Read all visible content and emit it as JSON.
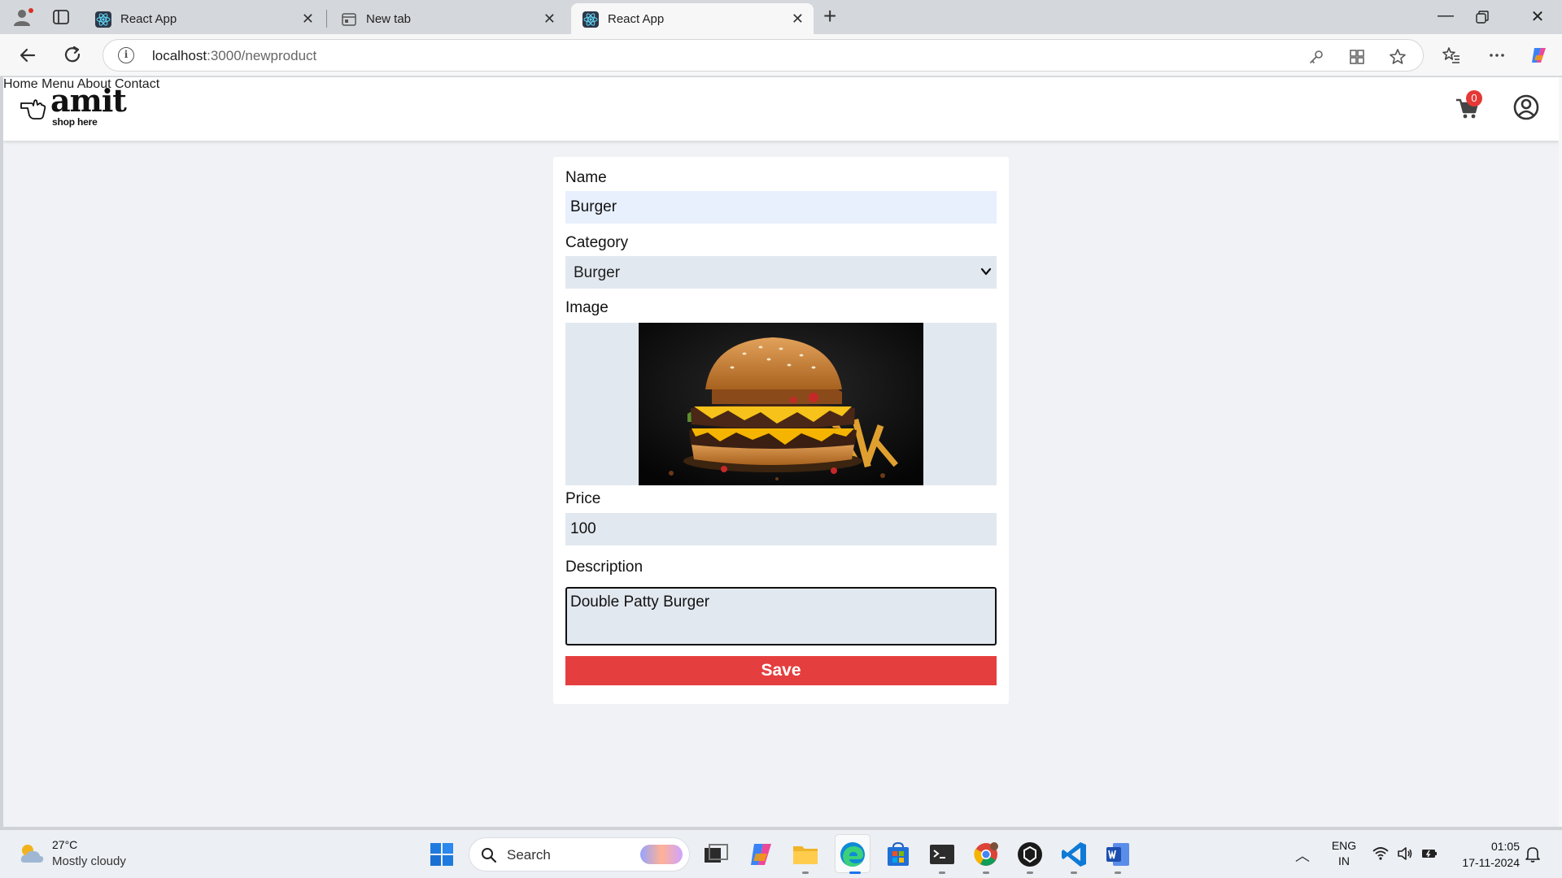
{
  "browser": {
    "tabs": [
      {
        "title": "React App",
        "active": false
      },
      {
        "title": "New tab",
        "active": false
      },
      {
        "title": "React App",
        "active": true
      }
    ],
    "url_host": "localhost",
    "url_path": ":3000/newproduct"
  },
  "app": {
    "logo_word": "amit",
    "logo_tagline": "shop here",
    "nav": [
      "Home",
      "Menu",
      "About",
      "Contact"
    ],
    "cart_count": "0"
  },
  "form": {
    "name_label": "Name",
    "name_value": "Burger",
    "category_label": "Category",
    "category_value": "Burger",
    "image_label": "Image",
    "price_label": "Price",
    "price_value": "100",
    "description_label": "Description",
    "description_value": "Double Patty Burger",
    "save_label": "Save"
  },
  "taskbar": {
    "weather_temp": "27°C",
    "weather_desc": "Mostly cloudy",
    "search_placeholder": "Search",
    "lang_line1": "ENG",
    "lang_line2": "IN",
    "time": "01:05",
    "date": "17-11-2024"
  },
  "colors": {
    "save_button": "#e53e3e",
    "input_bg": "#e2e8f0",
    "page_bg": "#f0f2f5",
    "cart_badge": "#e53935"
  }
}
